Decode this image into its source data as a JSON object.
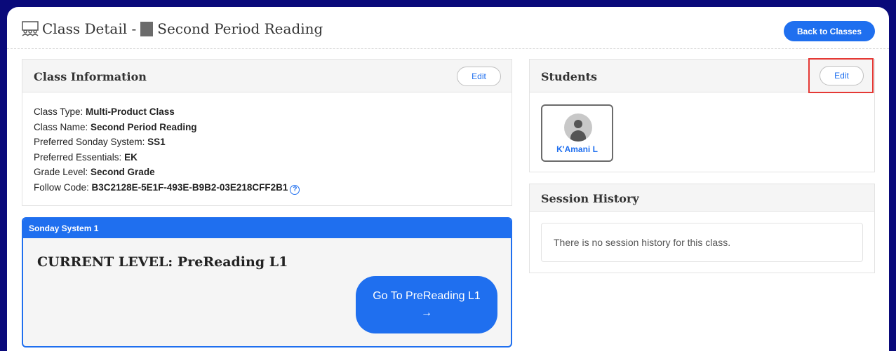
{
  "header": {
    "title_prefix": "Class Detail -",
    "title_class": "Second Period Reading",
    "back_button": "Back to Classes"
  },
  "class_info": {
    "title": "Class Information",
    "edit_label": "Edit",
    "rows": [
      {
        "label": "Class Type: ",
        "value": "Multi-Product Class"
      },
      {
        "label": "Class Name: ",
        "value": "Second Period Reading"
      },
      {
        "label": "Preferred Sonday System: ",
        "value": "SS1"
      },
      {
        "label": "Preferred Essentials: ",
        "value": "EK"
      },
      {
        "label": "Grade Level: ",
        "value": "Second Grade"
      },
      {
        "label": "Follow Code: ",
        "value": "B3C2128E-5E1F-493E-B9B2-03E218CFF2B1"
      }
    ]
  },
  "sonday": {
    "header": "Sonday System 1",
    "current_level": "CURRENT LEVEL: PreReading L1",
    "go_button": "Go To PreReading L1",
    "go_arrow": "→"
  },
  "students": {
    "title": "Students",
    "edit_label": "Edit",
    "list": [
      {
        "name": "K'Amani L"
      }
    ]
  },
  "session_history": {
    "title": "Session History",
    "empty_text": "There is no session history for this class."
  },
  "colors": {
    "accent": "#1f6fef",
    "top_bar": "#0a0a7a",
    "highlight": "#e53935"
  }
}
